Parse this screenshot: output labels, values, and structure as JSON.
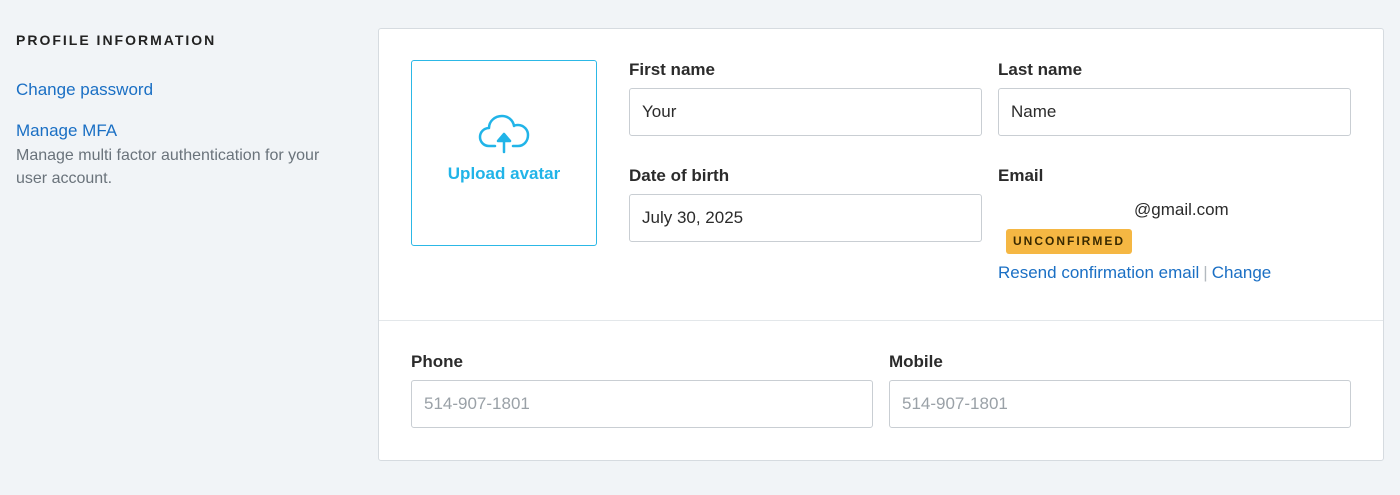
{
  "sidebar": {
    "title": "PROFILE INFORMATION",
    "change_password": "Change password",
    "manage_mfa": "Manage MFA",
    "mfa_description": "Manage multi factor authentication for your user account."
  },
  "avatar": {
    "upload_label": "Upload avatar",
    "icon": "cloud-upload-icon"
  },
  "form": {
    "first_name": {
      "label": "First name",
      "value": "Your"
    },
    "last_name": {
      "label": "Last name",
      "value": "Name"
    },
    "date_of_birth": {
      "label": "Date of birth",
      "value": "July 30, 2025"
    },
    "email": {
      "label": "Email",
      "value": "@gmail.com",
      "status": "UNCONFIRMED",
      "resend_link": "Resend confirmation email",
      "separator": "|",
      "change_link": "Change"
    },
    "phone": {
      "label": "Phone",
      "placeholder": "514-907-1801"
    },
    "mobile": {
      "label": "Mobile",
      "placeholder": "514-907-1801"
    }
  },
  "colors": {
    "link": "#1a6fc4",
    "accent": "#21b4e8",
    "badge": "#f5b743",
    "background": "#f1f4f7"
  }
}
